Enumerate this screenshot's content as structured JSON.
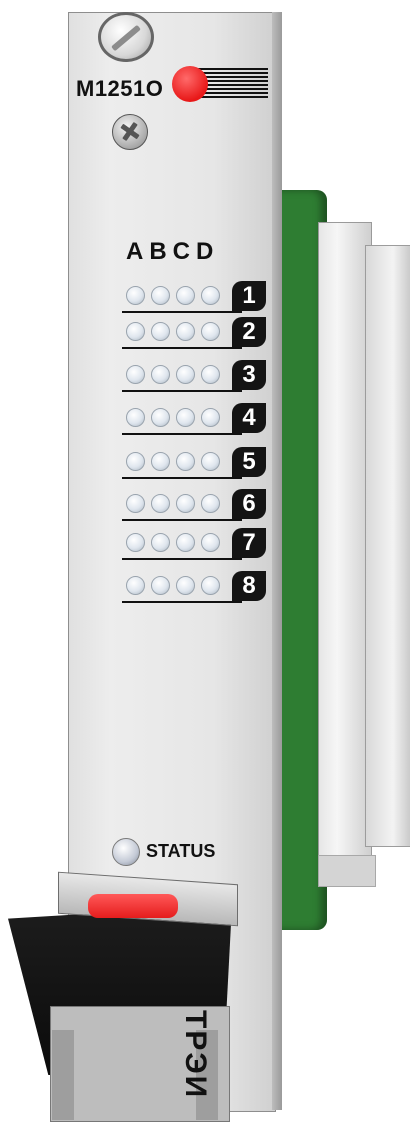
{
  "module": {
    "model": "M1251O",
    "columns": "ABCD",
    "rows": [
      {
        "num": "1"
      },
      {
        "num": "2"
      },
      {
        "num": "3"
      },
      {
        "num": "4"
      },
      {
        "num": "5"
      },
      {
        "num": "6"
      },
      {
        "num": "7"
      },
      {
        "num": "8"
      }
    ],
    "status_label": "STATUS",
    "brand": "ТРЭИ"
  },
  "colors": {
    "panel": "#e6e6e6",
    "pcb": "#2e7d32",
    "led_red": "#e81818",
    "handle": "#111111"
  }
}
